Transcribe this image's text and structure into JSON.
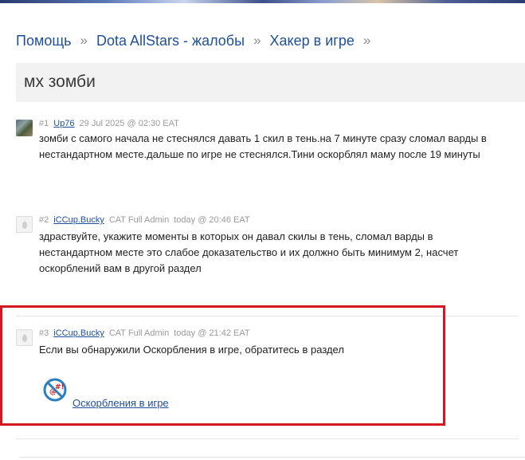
{
  "breadcrumb": {
    "items": [
      "Помощь",
      "Dota AllStars - жалобы",
      "Хакер в игре"
    ],
    "separator": "»"
  },
  "topic": {
    "title": "мх зомби"
  },
  "posts": [
    {
      "number": "#1",
      "author": "Up76",
      "group": "",
      "date": "29 Jul 2025 @ 02:30 EAT",
      "lines": [
        "зомби с самого начала не стеснялся давать 1 скил в тень.на 7 минуте сразу сломал варды в",
        "нестандартном месте.дальше по игре не стеснялся.Тини оскорблял маму после 19 минуты"
      ]
    },
    {
      "number": "#2",
      "author": "iCCup.Bucky",
      "group": "CAT Full Admin",
      "date": "today @ 20:46 EAT",
      "lines": [
        "здраствуйте, укажите моменты в которых он давал скилы в тень, сломал варды в",
        "нестандартном месте это слабое доказательство и их должно быть минимум 2, насчет",
        "оскорблений вам в другой раздел"
      ]
    },
    {
      "number": "#3",
      "author": "iCCup.Bucky",
      "group": "CAT Full Admin",
      "date": "today @ 21:42 EAT",
      "lines": [
        "Если вы обнаружили Оскорбления в игре, обратитесь в раздел"
      ],
      "link": {
        "label": "Оскорбления в игре",
        "icon": "no-insults-icon"
      }
    }
  ],
  "colors": {
    "link": "#1e4f9c",
    "highlight": "#d4181f",
    "title_bg": "#f2f2f2"
  }
}
